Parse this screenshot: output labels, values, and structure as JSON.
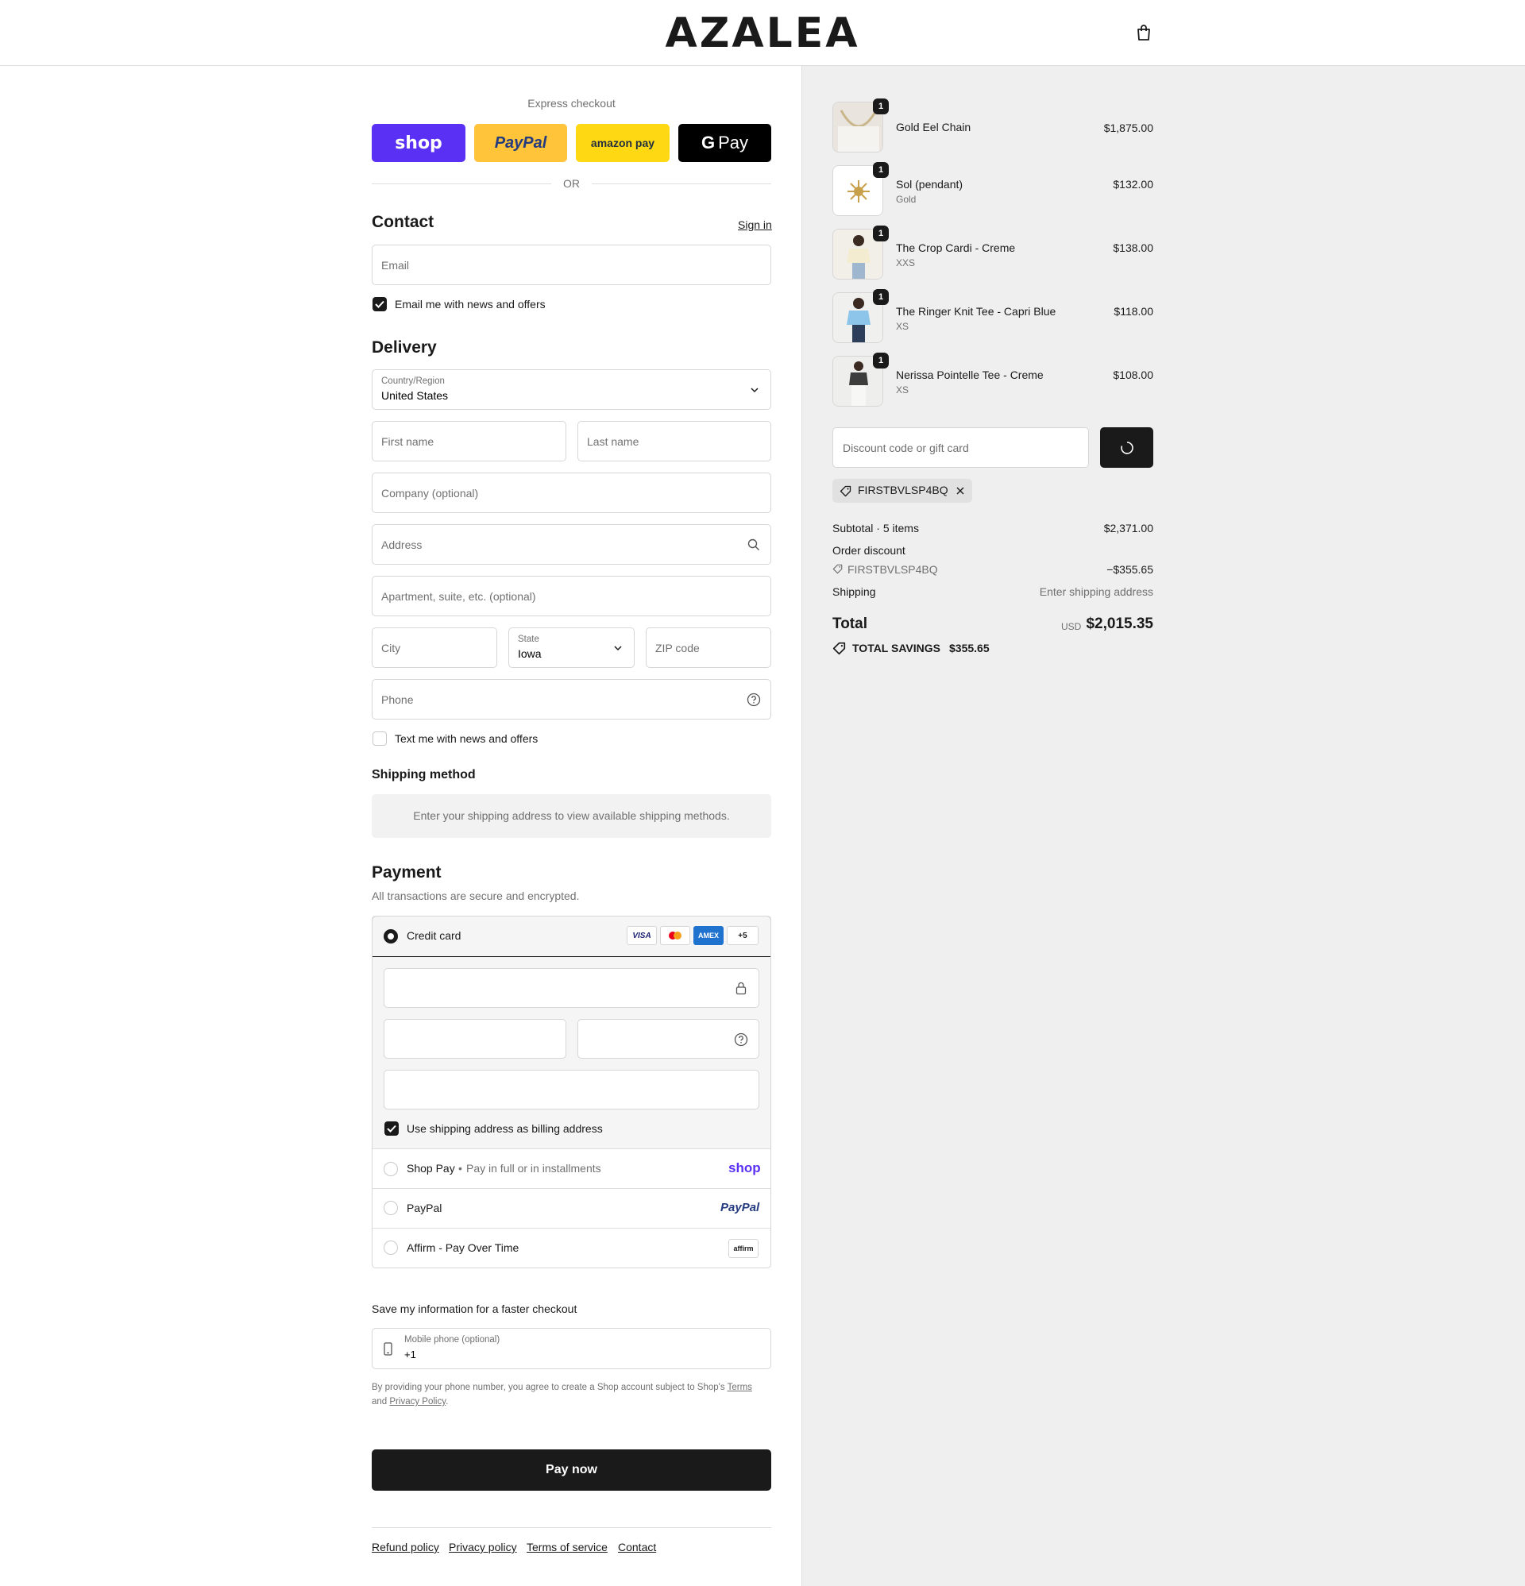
{
  "header": {
    "brand": "AZALEA"
  },
  "express": {
    "title": "Express checkout",
    "shop_label": "shop",
    "paypal_label": "PayPal",
    "amazon_label": "amazon pay",
    "gpay_label": "Pay",
    "or_label": "OR"
  },
  "contact": {
    "title": "Contact",
    "sign_in": "Sign in",
    "email_placeholder": "Email",
    "news_label": "Email me with news and offers"
  },
  "delivery": {
    "title": "Delivery",
    "country_label": "Country/Region",
    "country_value": "United States",
    "first_name": "First name",
    "last_name": "Last name",
    "company": "Company (optional)",
    "address": "Address",
    "apartment": "Apartment, suite, etc. (optional)",
    "city": "City",
    "state_label": "State",
    "state_value": "Iowa",
    "zip": "ZIP code",
    "phone": "Phone",
    "text_label": "Text me with news and offers"
  },
  "shipping_method": {
    "title": "Shipping method",
    "notice": "Enter your shipping address to view available shipping methods."
  },
  "payment": {
    "title": "Payment",
    "subtitle": "All transactions are secure and encrypted.",
    "credit_card": "Credit card",
    "cards": [
      "VISA",
      "MC",
      "AMEX",
      "+5"
    ],
    "billing_label": "Use shipping address as billing address",
    "shop_pay": "Shop Pay",
    "shop_pay_sub": "Pay in full or in installments",
    "shop_pay_logo": "shop",
    "paypal": "PayPal",
    "paypal_logo": "PayPal",
    "affirm": "Affirm - Pay Over Time",
    "affirm_logo": "affirm"
  },
  "save_info": {
    "title": "Save my information for a faster checkout",
    "mobile_label": "Mobile phone (optional)",
    "mobile_value": "+1",
    "legal_prefix": "By providing your phone number, you agree to create a Shop account subject to Shop's",
    "terms": "Terms",
    "and": "and",
    "privacy": "Privacy Policy",
    "period": "."
  },
  "pay_now": "Pay now",
  "footer_links": [
    "Refund policy",
    "Privacy policy",
    "Terms of service",
    "Contact"
  ],
  "cart": {
    "items": [
      {
        "name": "Gold Eel Chain",
        "variant": "",
        "price": "$1,875.00",
        "qty": "1"
      },
      {
        "name": "Sol (pendant)",
        "variant": "Gold",
        "price": "$132.00",
        "qty": "1"
      },
      {
        "name": "The Crop Cardi - Creme",
        "variant": "XXS",
        "price": "$138.00",
        "qty": "1"
      },
      {
        "name": "The Ringer Knit Tee - Capri Blue",
        "variant": "XS",
        "price": "$118.00",
        "qty": "1"
      },
      {
        "name": "Nerissa Pointelle Tee - Creme",
        "variant": "XS",
        "price": "$108.00",
        "qty": "1"
      }
    ],
    "discount_placeholder": "Discount code or gift card",
    "applied_code": "FIRSTBVLSP4BQ",
    "subtotal_label": "Subtotal · 5 items",
    "subtotal_value": "$2,371.00",
    "order_discount_label": "Order discount",
    "discount_code": "FIRSTBVLSP4BQ",
    "discount_value": "−$355.65",
    "shipping_label": "Shipping",
    "shipping_value": "Enter shipping address",
    "total_label": "Total",
    "currency": "USD",
    "total_value": "$2,015.35",
    "savings_label": "TOTAL SAVINGS",
    "savings_value": "$355.65"
  }
}
